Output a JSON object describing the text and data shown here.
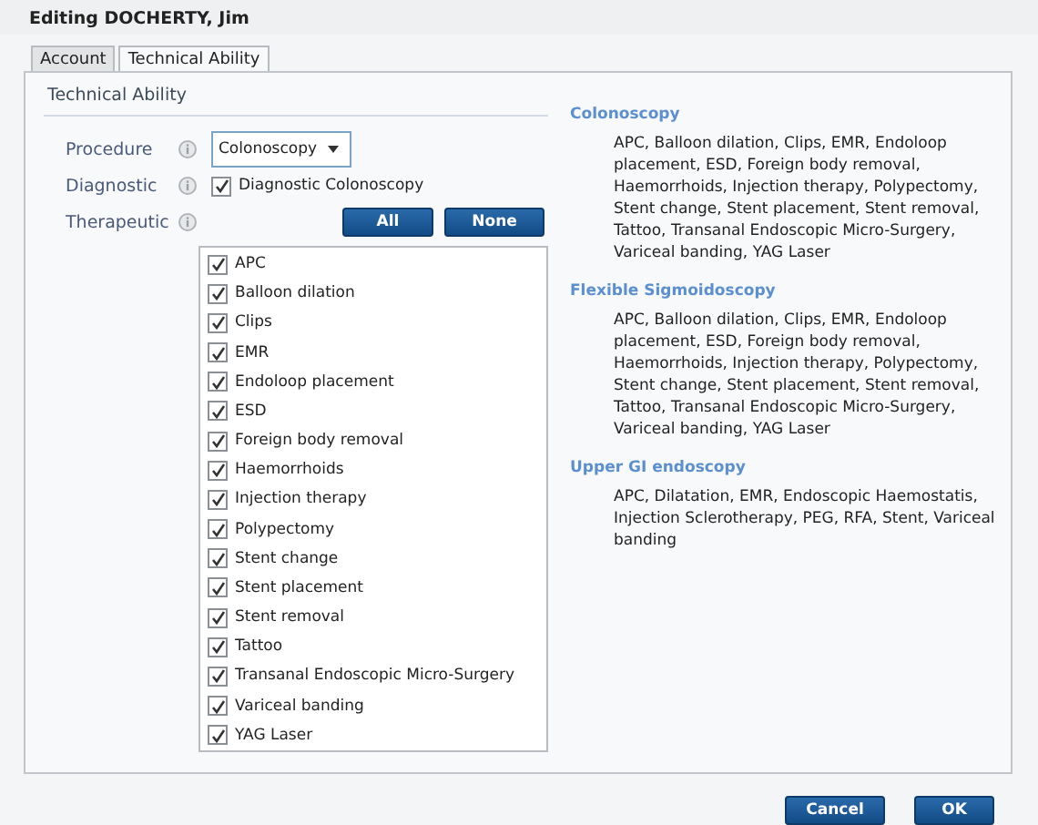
{
  "window": {
    "title": "Editing DOCHERTY, Jim"
  },
  "tabs": [
    {
      "label": "Account",
      "selected": false
    },
    {
      "label": "Technical Ability",
      "selected": true
    }
  ],
  "section": {
    "title": "Technical Ability"
  },
  "form": {
    "procedure": {
      "label": "Procedure",
      "value": "Colonoscopy"
    },
    "diagnostic": {
      "label": "Diagnostic",
      "option": "Diagnostic Colonoscopy",
      "checked": true
    },
    "therapeutic": {
      "label": "Therapeutic",
      "buttons": [
        "All",
        "None"
      ],
      "items": [
        {
          "label": "APC",
          "checked": true
        },
        {
          "label": "Balloon dilation",
          "checked": true
        },
        {
          "label": "Clips",
          "checked": true
        },
        {
          "label": "EMR",
          "checked": true
        },
        {
          "label": "Endoloop placement",
          "checked": true
        },
        {
          "label": "ESD",
          "checked": true
        },
        {
          "label": "Foreign body removal",
          "checked": true
        },
        {
          "label": "Haemorrhoids",
          "checked": true
        },
        {
          "label": "Injection therapy",
          "checked": true
        },
        {
          "label": "Polypectomy",
          "checked": true
        },
        {
          "label": "Stent change",
          "checked": true
        },
        {
          "label": "Stent placement",
          "checked": true
        },
        {
          "label": "Stent removal",
          "checked": true
        },
        {
          "label": "Tattoo",
          "checked": true
        },
        {
          "label": "Transanal Endoscopic Micro-Surgery",
          "checked": true
        },
        {
          "label": "Variceal banding",
          "checked": true
        },
        {
          "label": "YAG Laser",
          "checked": true
        }
      ]
    }
  },
  "summary": [
    {
      "heading": "Colonoscopy",
      "text": "APC, Balloon dilation, Clips, EMR, Endoloop placement, ESD, Foreign body removal, Haemorrhoids, Injection therapy, Polypectomy, Stent change, Stent placement, Stent removal, Tattoo, Transanal Endoscopic Micro-Surgery, Variceal banding, YAG Laser"
    },
    {
      "heading": "Flexible Sigmoidoscopy",
      "text": "APC, Balloon dilation, Clips, EMR, Endoloop placement, ESD, Foreign body removal, Haemorrhoids, Injection therapy, Polypectomy, Stent change, Stent placement, Stent removal, Tattoo, Transanal Endoscopic Micro-Surgery, Variceal banding, YAG Laser"
    },
    {
      "heading": "Upper GI endoscopy",
      "text": "APC, Dilatation, EMR, Endoscopic Haemostatis, Injection Sclerotherapy, PEG, RFA, Stent, Variceal banding"
    }
  ],
  "footer": {
    "buttons": [
      "Cancel",
      "OK"
    ]
  }
}
